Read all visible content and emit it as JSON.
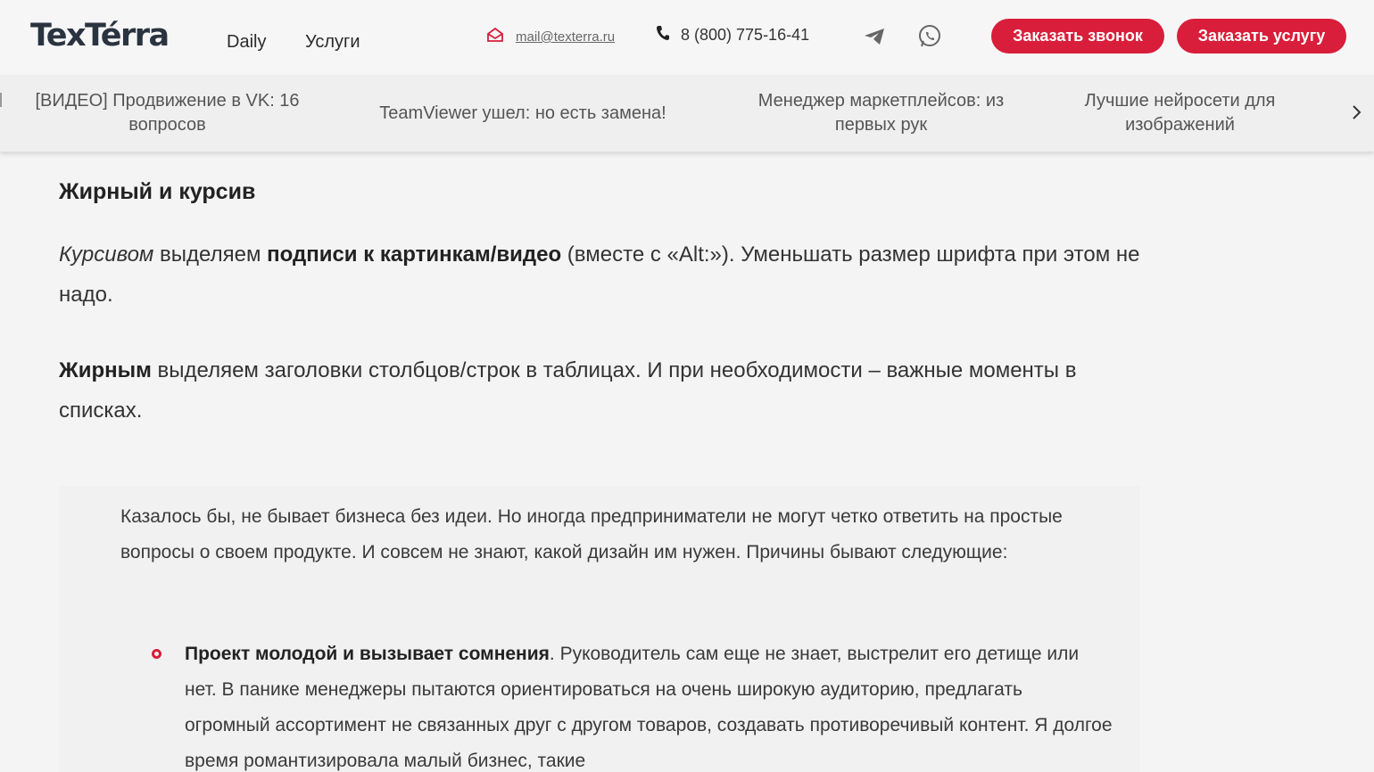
{
  "header": {
    "logo": "TexTérra",
    "nav": [
      "Daily",
      "Услуги"
    ],
    "email": "mail@texterra.ru",
    "phone": "8 (800) 775-16-41",
    "btn_call": "Заказать звонок",
    "btn_service": "Заказать услугу"
  },
  "ticker": {
    "items": [
      "[ВИДЕО] Продвижение в VK: 16 вопросов",
      "TeamViewer ушел: но есть замена!",
      "Менеджер маркетплейсов: из первых рук",
      "Лучшие нейросети для изображений"
    ]
  },
  "content": {
    "heading": "Жирный и курсив",
    "p1_italic": "Курсивом",
    "p1_a": " выделяем ",
    "p1_bold": "подписи к картинкам/видео",
    "p1_b": " (вместе с «Alt:»). Уменьшать размер шрифта при этом не надо.",
    "p2_bold": "Жирным",
    "p2_rest": " выделяем заголовки столбцов/строк в таблицах. И при необходимости – важные моменты в списках.",
    "quote": "Казалось бы, не бывает бизнеса без идеи. Но иногда предприниматели не могут четко ответить на простые вопросы о своем продукте. И совсем не знают, какой дизайн им нужен. Причины бывают следующие:",
    "list_bold": "Проект молодой и вызывает сомнения",
    "list_rest": ". Руководитель сам еще не знает, выстрелит его детище или нет. В панике менеджеры пытаются ориентироваться на очень широкую аудиторию, предлагать огромный ассортимент не связанных друг с другом товаров, создавать противоречивый контент. Я долгое время романтизировала малый бизнес, такие"
  },
  "colors": {
    "accent": "#d81e3a",
    "logo": "#2a3440"
  },
  "icons": [
    "mail-icon",
    "phone-icon",
    "telegram-icon",
    "whatsapp-icon",
    "chevron-right-icon"
  ]
}
